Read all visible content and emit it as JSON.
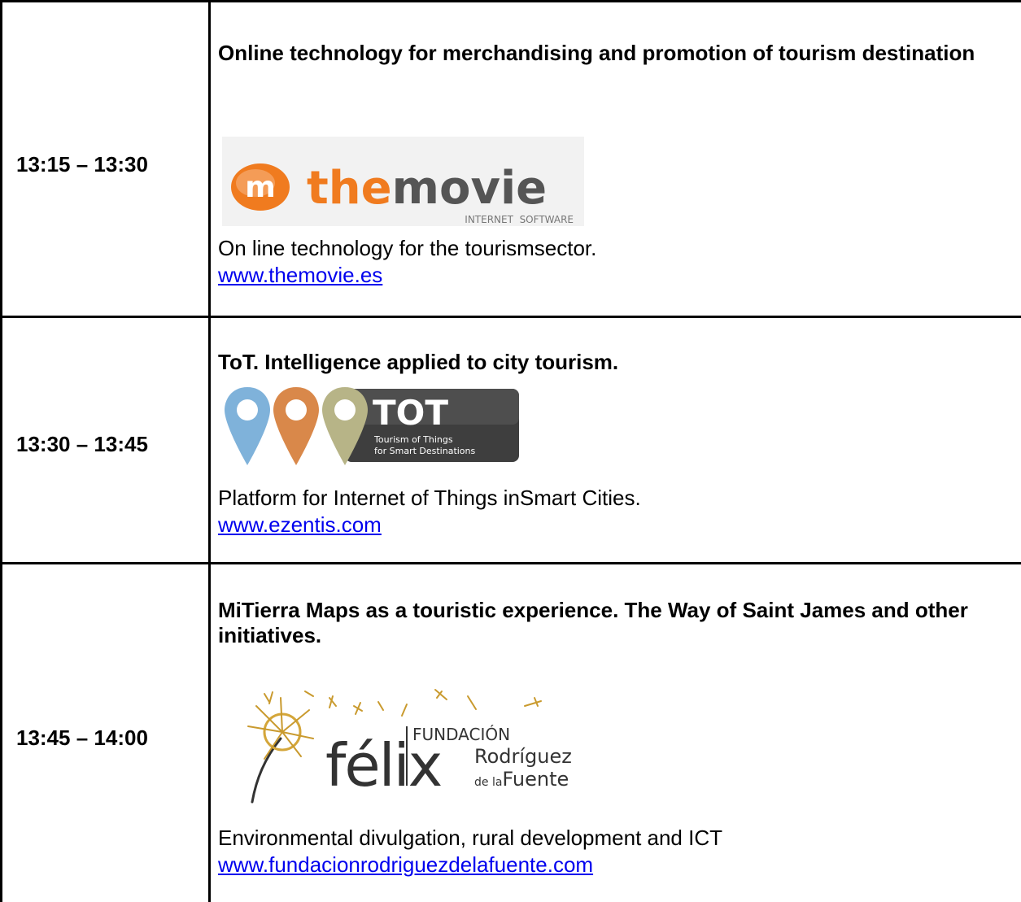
{
  "rows": [
    {
      "time": "13:15 – 13:30",
      "title": "Online technology for merchandising and promotion of tourism destination",
      "logo": {
        "word1": "the",
        "word2": "movie",
        "tagline": "INTERNET  SOFTWARE",
        "badge_letter": "m",
        "brand_color": "#F07B1F"
      },
      "description": "On line technology for the tourismsector.",
      "link": "www.themovie.es"
    },
    {
      "time": "13:30 – 13:45",
      "title": "ToT. Intelligence applied to city tourism.",
      "logo": {
        "name": "TOT",
        "line1": "Tourism of Things",
        "line2": "for Smart Destinations",
        "pin_colors": [
          "#7FB2DA",
          "#D9884A",
          "#B7B487"
        ]
      },
      "description": "Platform for Internet of Things inSmart Cities.",
      "link": "www.ezentis.com"
    },
    {
      "time": "13:45 – 14:00",
      "title": "MiTierra Maps as a touristic experience. The Way of Saint James and other initiatives.",
      "logo": {
        "top": "FUNDACIÓN",
        "main": "félix",
        "line1": "Rodríguez",
        "line2_small": "de la",
        "line2": "Fuente"
      },
      "description": "Environmental divulgation, rural development and ICT",
      "link": "www.fundacionrodriguezdelafuente.com"
    }
  ]
}
